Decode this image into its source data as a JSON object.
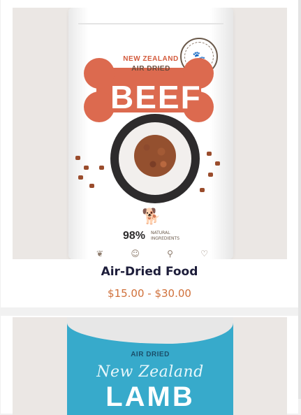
{
  "products": [
    {
      "name": "Air-Dried Food",
      "price": "$15.00 - $30.00",
      "image": {
        "line1": "NEW ZEALAND",
        "line2": "AIR DRIED",
        "flavor": "BEEF",
        "stat_value": "98%",
        "stat_label": "NATURAL INGREDIENTS",
        "icons": [
          "leaf-icon",
          "dog-icon",
          "bone-icon",
          "heart-icon"
        ]
      }
    },
    {
      "image": {
        "line1": "AIR DRIED",
        "line2": "New Zealand",
        "flavor": "LAMB"
      }
    }
  ],
  "colors": {
    "accent": "#d0703a",
    "title": "#1d1d3a",
    "beef": "#dc6a4f",
    "lamb": "#37aacb"
  }
}
